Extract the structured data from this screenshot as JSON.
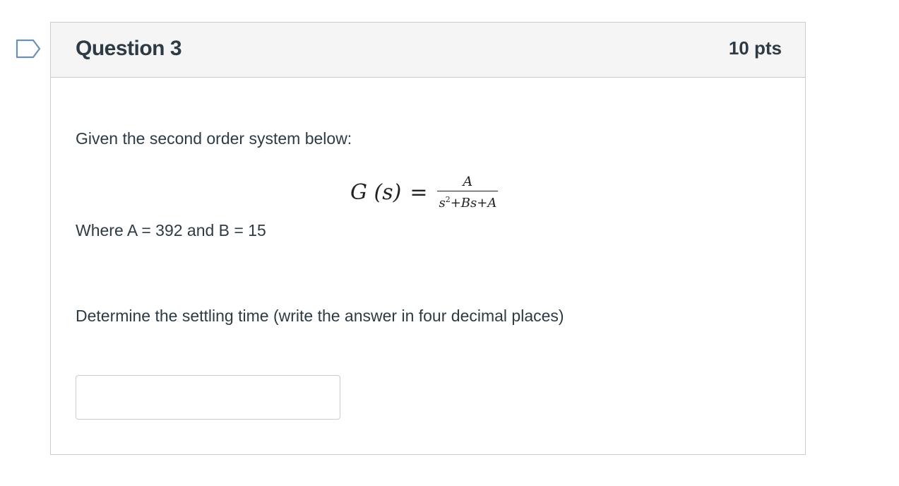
{
  "question": {
    "title": "Question 3",
    "points": "10 pts",
    "intro": "Given the second order system below:",
    "equation": {
      "lhs": "G (s)",
      "equals": "=",
      "numerator": "A",
      "denominator_base": "s",
      "denominator_exp": "2",
      "denominator_rest": "+Bs+A"
    },
    "given": "Where A = 392 and B = 15",
    "prompt": "Determine the settling time (write the answer in four decimal places)",
    "answer": {
      "value": "",
      "placeholder": ""
    }
  },
  "colors": {
    "header_bg": "#f5f5f5",
    "border": "#c7cdd1",
    "text": "#2d3b45",
    "flag_stroke": "#6a90b5"
  },
  "icons": {
    "flag": "bookmark-flag-icon"
  }
}
